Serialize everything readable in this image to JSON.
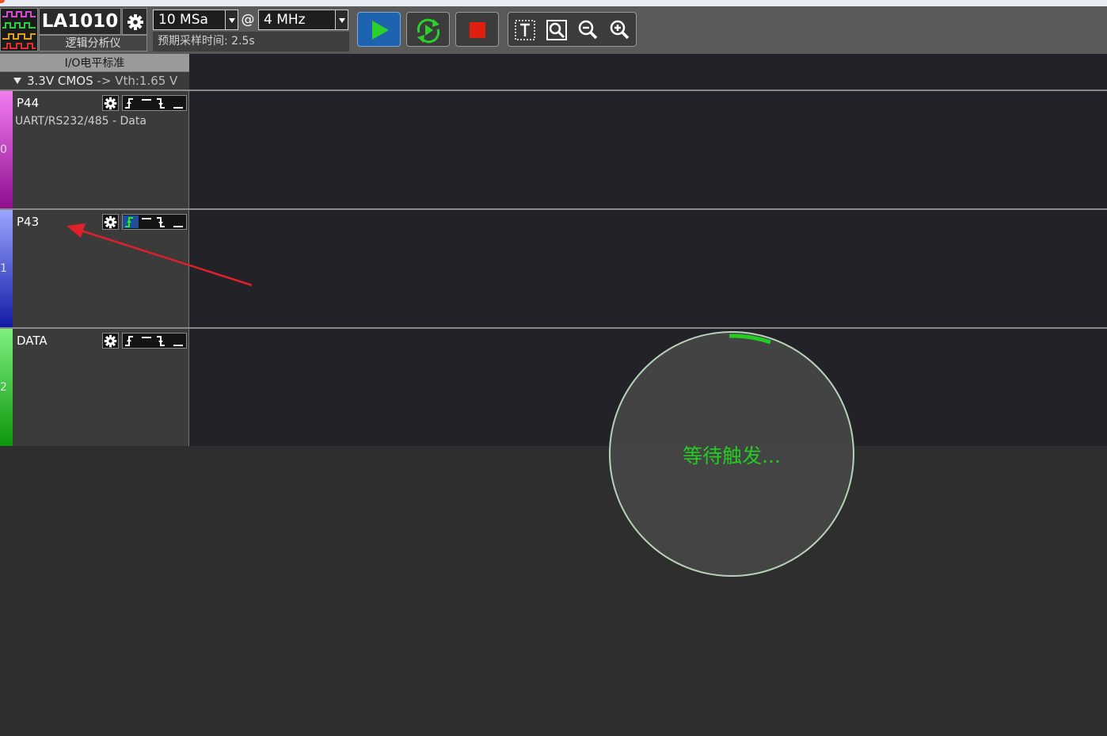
{
  "toolbar": {
    "device_name": "LA1010",
    "device_subtitle": "逻辑分析仪",
    "sample_depth": "10 MSa",
    "at_symbol": "@",
    "sample_rate": "4 MHz",
    "sample_time": "预期采样时间: 2.5s"
  },
  "io_standard": {
    "header": "I/O电平标准",
    "standard": "3.3V CMOS",
    "arrow": "->",
    "threshold": "Vth:1.65 V"
  },
  "channels": [
    {
      "index": "0",
      "name": "P44",
      "subtitle": "UART/RS232/485 - Data",
      "color_top": "#f27cf2",
      "color_bottom": "#8f0f8f",
      "active_trigger": ""
    },
    {
      "index": "1",
      "name": "P43",
      "subtitle": "",
      "color_top": "#9aa6ff",
      "color_bottom": "#141aa6",
      "active_trigger": "rising-edge"
    },
    {
      "index": "2",
      "name": "DATA",
      "subtitle": "",
      "color_top": "#7ef07e",
      "color_bottom": "#0c960c",
      "active_trigger": ""
    }
  ],
  "overlay": {
    "waiting_text": "等待触发..."
  },
  "colors": {
    "run_button": "#1e63b0",
    "accent_green": "#22cc22",
    "stop_red": "#e01e10",
    "annotation_arrow": "#e0202a"
  }
}
